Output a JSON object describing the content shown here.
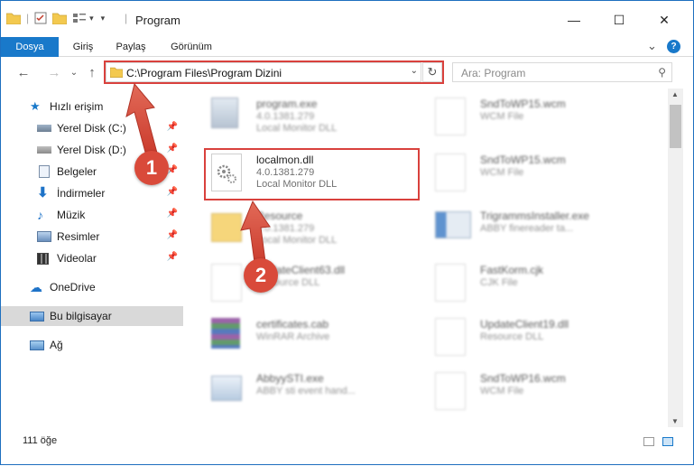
{
  "window": {
    "title": "Program",
    "minimize": "—",
    "maximize": "☐",
    "close": "✕"
  },
  "ribbon": {
    "tabs": [
      "Dosya",
      "Giriş",
      "Paylaş",
      "Görünüm"
    ],
    "active_tab": "Dosya",
    "expand_icon": "⌄",
    "help_icon": "?"
  },
  "nav": {
    "back": "←",
    "forward": "→",
    "history": "⌄",
    "up": "↑",
    "address": "C:\\Program Files\\Program Dizini",
    "address_dropdown": "⌄",
    "refresh": "↻",
    "search_placeholder": "Ara: Program",
    "search_icon": "⚲"
  },
  "sidebar": {
    "items": [
      {
        "label": "Hızlı erişim",
        "icon": "star-icon",
        "pinned": false
      },
      {
        "label": "Yerel Disk (C:)",
        "icon": "drive-icon",
        "pinned": true
      },
      {
        "label": "Yerel Disk (D:)",
        "icon": "drive-icon",
        "pinned": true
      },
      {
        "label": "Belgeler",
        "icon": "documents-icon",
        "pinned": true
      },
      {
        "label": "İndirmeler",
        "icon": "download-icon",
        "pinned": true
      },
      {
        "label": "Müzik",
        "icon": "music-icon",
        "pinned": true
      },
      {
        "label": "Resimler",
        "icon": "pictures-icon",
        "pinned": true
      },
      {
        "label": "Videolar",
        "icon": "videos-icon",
        "pinned": true
      },
      {
        "label": "OneDrive",
        "icon": "cloud-icon",
        "pinned": false
      },
      {
        "label": "Bu bilgisayar",
        "icon": "computer-icon",
        "pinned": false
      },
      {
        "label": "Ağ",
        "icon": "network-icon",
        "pinned": false
      }
    ],
    "selected": "Bu bilgisayar",
    "pin_glyph": "📌"
  },
  "files": {
    "left": [
      {
        "name": "program.exe",
        "line1": "4.0.1381.279",
        "line2": "Local Monitor DLL"
      },
      {
        "name": "localmon.dll",
        "line1": "4.0.1381.279",
        "line2": "Local Monitor DLL"
      },
      {
        "name": "Resource",
        "line1": "4.0.1381.279",
        "line2": "Local Monitor DLL"
      },
      {
        "name": "UpdateClient63.dll",
        "line1": "Resource DLL",
        "line2": ""
      },
      {
        "name": "certificates.cab",
        "line1": "WinRAR Archive",
        "line2": ""
      },
      {
        "name": "AbbyySTI.exe",
        "line1": "ABBY sti event hand...",
        "line2": ""
      }
    ],
    "right": [
      {
        "name": "SndToWP15.wcm",
        "line1": "WCM File",
        "line2": ""
      },
      {
        "name": "SndToWP15.wcm",
        "line1": "WCM File",
        "line2": ""
      },
      {
        "name": "TrigrammsInstaller.exe",
        "line1": "ABBY finereader ta...",
        "line2": ""
      },
      {
        "name": "FastKorm.cjk",
        "line1": "CJK File",
        "line2": ""
      },
      {
        "name": "UpdateClient19.dll",
        "line1": "Resource DLL",
        "line2": ""
      },
      {
        "name": "SndToWP16.wcm",
        "line1": "WCM File",
        "line2": ""
      }
    ]
  },
  "status": {
    "count": "111 öğe"
  },
  "annotations": {
    "step1": "1",
    "step2": "2",
    "highlight_color": "#d9413d"
  }
}
